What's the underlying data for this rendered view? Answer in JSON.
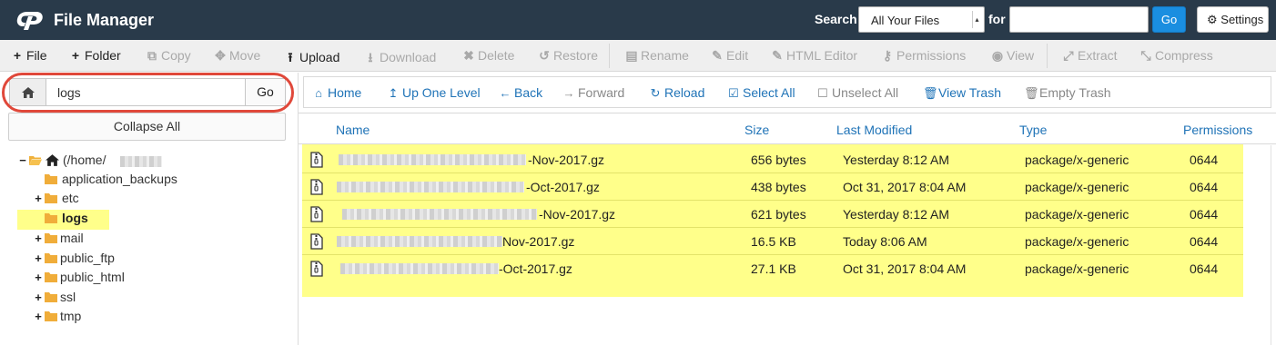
{
  "header": {
    "title": "File Manager",
    "search_label": "Search",
    "scope": "All Your Files",
    "for_label": "for",
    "search_value": "",
    "go_label": "Go",
    "settings_label": "Settings"
  },
  "toolbar": {
    "file": "File",
    "folder": "Folder",
    "copy": "Copy",
    "move": "Move",
    "upload": "Upload",
    "download": "Download",
    "delete": "Delete",
    "restore": "Restore",
    "rename": "Rename",
    "edit": "Edit",
    "html_editor": "HTML Editor",
    "permissions": "Permissions",
    "view": "View",
    "extract": "Extract",
    "compress": "Compress"
  },
  "sidebar": {
    "path_value": "logs",
    "go_label": "Go",
    "collapse_label": "Collapse All",
    "tree": {
      "root": "(/home/",
      "application_backups": "application_backups",
      "etc": "etc",
      "logs": "logs",
      "mail": "mail",
      "public_ftp": "public_ftp",
      "public_html": "public_html",
      "ssl": "ssl",
      "tmp": "tmp"
    }
  },
  "nav": {
    "home": "Home",
    "up": "Up One Level",
    "back": "Back",
    "forward": "Forward",
    "reload": "Reload",
    "select_all": "Select All",
    "unselect_all": "Unselect All",
    "view_trash": "View Trash",
    "empty_trash": "Empty Trash"
  },
  "table": {
    "columns": {
      "name": "Name",
      "size": "Size",
      "modified": "Last Modified",
      "type": "Type",
      "permissions": "Permissions"
    },
    "rows": [
      {
        "name": "-Nov-2017.gz",
        "size": "656 bytes",
        "modified": "Yesterday 8:12 AM",
        "type": "package/x-generic",
        "perms": "0644"
      },
      {
        "name": "-Oct-2017.gz",
        "size": "438 bytes",
        "modified": "Oct 31, 2017 8:04 AM",
        "type": "package/x-generic",
        "perms": "0644"
      },
      {
        "name": "-Nov-2017.gz",
        "size": "621 bytes",
        "modified": "Yesterday 8:12 AM",
        "type": "package/x-generic",
        "perms": "0644"
      },
      {
        "name": "Nov-2017.gz",
        "size": "16.5 KB",
        "modified": "Today 8:06 AM",
        "type": "package/x-generic",
        "perms": "0644"
      },
      {
        "name": "-Oct-2017.gz",
        "size": "27.1 KB",
        "modified": "Oct 31, 2017 8:04 AM",
        "type": "package/x-generic",
        "perms": "0644"
      }
    ]
  }
}
